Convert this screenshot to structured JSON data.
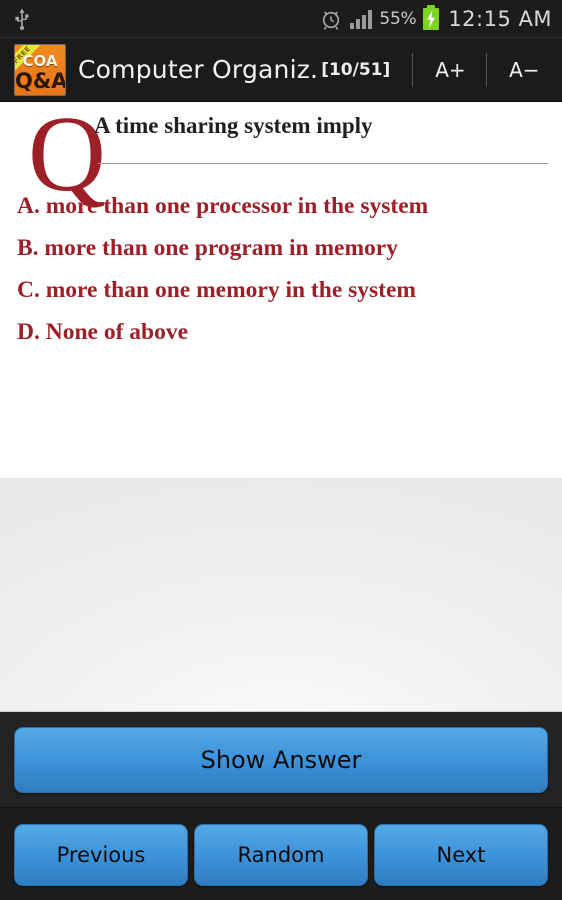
{
  "status_bar": {
    "usb_icon": "usb-icon",
    "alarm_icon": "alarm-clock-icon",
    "signal_icon": "signal-bars-icon",
    "battery_percent": "55%",
    "battery_icon": "battery-charging-icon",
    "time": "12:15 AM"
  },
  "app_bar": {
    "icon": {
      "ribbon": "FREE",
      "line1": "COA",
      "line2": "Q&A"
    },
    "title": "Computer Organiz...",
    "counter": "[10/51]",
    "font_increase": "A+",
    "font_decrease": "A−"
  },
  "question": {
    "marker": "Q",
    "text": "A time sharing system imply",
    "options": [
      "A. more than one processor in the system",
      "B. more than one program in memory",
      "C. more than one memory in the system",
      "D. None of above"
    ]
  },
  "answer": {
    "text": ""
  },
  "buttons": {
    "show_answer": "Show Answer",
    "previous": "Previous",
    "random": "Random",
    "next": "Next"
  },
  "colors": {
    "accent_red": "#9d2029",
    "button_blue": "#3f95dc",
    "app_icon_orange": "#e8741a",
    "battery_green": "#7ed321",
    "bar_dark": "#1b1b1b"
  }
}
